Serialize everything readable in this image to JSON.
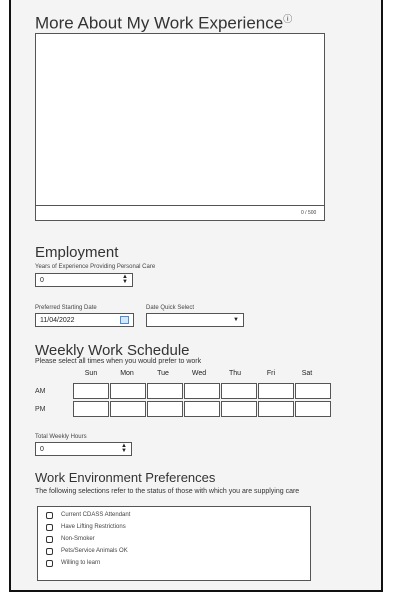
{
  "experience": {
    "title": "More About My Work Experience",
    "info_icon": "info-circle-icon",
    "counter": "0 / 500"
  },
  "employment": {
    "title": "Employment",
    "years_label": "Years of Experience Providing Personal Care",
    "years_value": "0",
    "start_label": "Preferred Starting Date",
    "start_value": "11/04/2022",
    "calendar_icon": "calendar-icon",
    "quick_label": "Date Quick Select",
    "quick_value": ""
  },
  "schedule": {
    "title": "Weekly Work Schedule",
    "subtitle": "Please select all times when you would prefer to work",
    "days": [
      "Sun",
      "Mon",
      "Tue",
      "Wed",
      "Thu",
      "Fri",
      "Sat"
    ],
    "rows": [
      "AM",
      "PM"
    ],
    "total_label": "Total Weekly Hours",
    "total_value": "0"
  },
  "environment": {
    "title": "Work Environment Preferences",
    "subtitle": "The following selections refer to the status of those with which you are supplying care",
    "options": [
      "Current CDASS Attendant",
      "Have Lifting Restrictions",
      "Non-Smoker",
      "Pets/Service Animals OK",
      "Willing to learn"
    ]
  }
}
